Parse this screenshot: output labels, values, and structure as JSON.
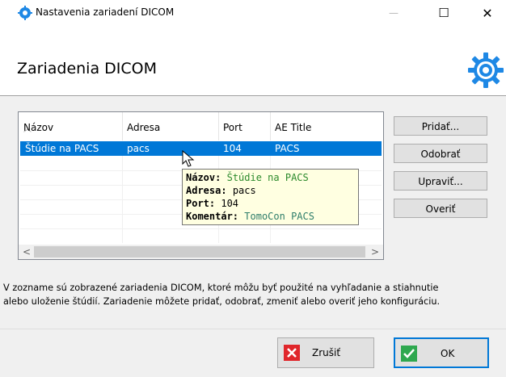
{
  "window": {
    "title": "Nastavenia zariadení DICOM",
    "min_glyph": "—",
    "max_glyph": "☐",
    "close_glyph": "✕"
  },
  "header": {
    "title": "Zariadenia DICOM",
    "icon": "gear-icon"
  },
  "table": {
    "columns": [
      "Názov",
      "Adresa",
      "Port",
      "AE Title"
    ],
    "sort_column": "Názov",
    "rows": [
      {
        "name": "Štúdie na PACS",
        "address": "pacs",
        "port": "104",
        "ae_title": "PACS",
        "selected": true
      }
    ]
  },
  "buttons": {
    "add": "Pridať...",
    "remove": "Odobrať",
    "edit": "Upraviť...",
    "verify": "Overiť"
  },
  "tooltip": {
    "name_label": "Názov:",
    "name_value": "Štúdie na PACS",
    "address_label": "Adresa:",
    "address_value": "pacs",
    "port_label": "Port:",
    "port_value": "104",
    "comment_label": "Komentár:",
    "comment_value": "TomoCon PACS"
  },
  "description": {
    "line1": "V zozname sú zobrazené zariadenia DICOM, ktoré môžu byť použité na vyhľadanie a stiahnutie",
    "line2": "alebo uloženie štúdií. Zariadenie môžete pridať, odobrať, zmeniť alebo overiť jeho konfiguráciu."
  },
  "footer": {
    "cancel": "Zrušiť",
    "ok": "OK"
  },
  "colors": {
    "selection": "#0078d7",
    "tooltip_bg": "#ffffe1",
    "ok_border": "#0078d7",
    "cancel_red": "#e0262b",
    "ok_green": "#2fa84f"
  }
}
